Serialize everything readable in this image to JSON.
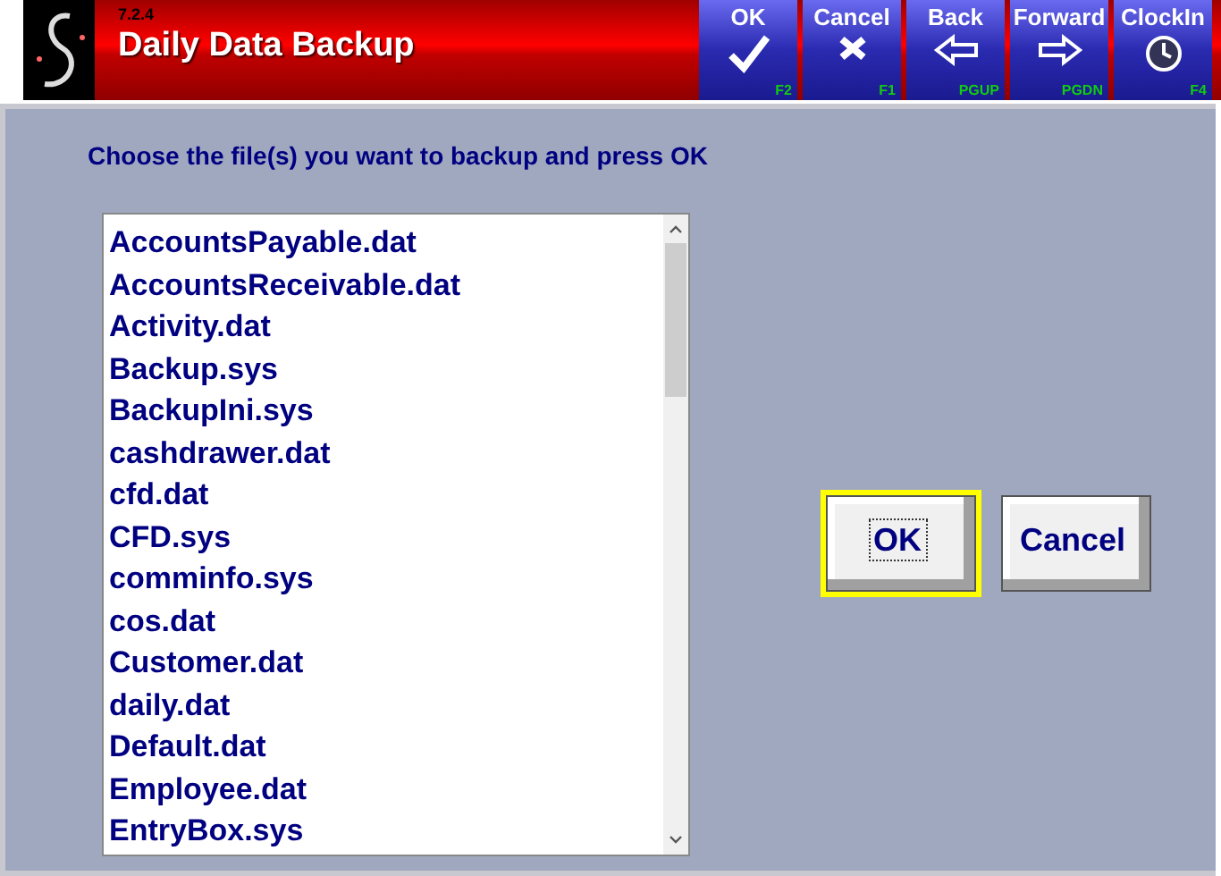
{
  "header": {
    "version": "7.2.4",
    "title": "Daily Data Backup"
  },
  "toolbar": [
    {
      "label": "OK",
      "kind": "check",
      "key": "F2"
    },
    {
      "label": "Cancel",
      "kind": "cancel",
      "key": "F1"
    },
    {
      "label": "Back",
      "kind": "back",
      "key": "PGUP"
    },
    {
      "label": "Forward",
      "kind": "forward",
      "key": "PGDN"
    },
    {
      "label": "ClockIn",
      "kind": "clock",
      "key": "F4"
    }
  ],
  "instruction": "Choose the file(s) you want to backup and press OK",
  "files": [
    {
      "name": "AccountsPayable.dat",
      "selected": false
    },
    {
      "name": "AccountsReceivable.dat",
      "selected": false
    },
    {
      "name": "Activity.dat",
      "selected": false
    },
    {
      "name": "Backup.sys",
      "selected": false
    },
    {
      "name": "BackupIni.sys",
      "selected": false
    },
    {
      "name": "cashdrawer.dat",
      "selected": false
    },
    {
      "name": "cfd.dat",
      "selected": false
    },
    {
      "name": "CFD.sys",
      "selected": false
    },
    {
      "name": "comminfo.sys",
      "selected": false
    },
    {
      "name": "cos.dat",
      "selected": false
    },
    {
      "name": "Customer.dat",
      "selected": false
    },
    {
      "name": "daily.dat",
      "selected": false
    },
    {
      "name": "Default.dat",
      "selected": false
    },
    {
      "name": "Employee.dat",
      "selected": false
    },
    {
      "name": "EntryBox.sys",
      "selected": false
    }
  ],
  "buttons": [
    {
      "label": "OK",
      "focused": true
    },
    {
      "label": "Cancel",
      "focused": false
    }
  ]
}
